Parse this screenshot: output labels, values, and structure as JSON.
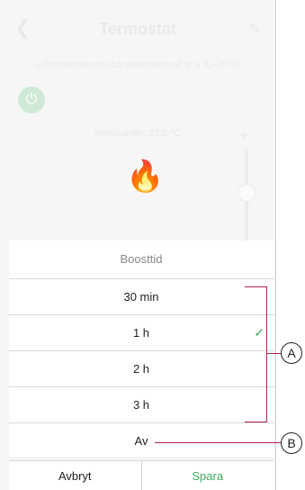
{
  "background": {
    "title": "Termostat",
    "range_text": "Lufttemperaturens börvärdesintervall är 4 ºC–30 ºC",
    "current_text": "Nuvarande: 23,5 ºC",
    "back_icon": "chevron-left-icon",
    "edit_icon": "pencil-icon",
    "power_icon": "power-icon",
    "flame_icon": "flame-icon",
    "plus_label": "+"
  },
  "sheet": {
    "title": "Boosttid",
    "options": [
      {
        "label": "30 min"
      },
      {
        "label": "1 h",
        "selected": true
      },
      {
        "label": "2 h"
      },
      {
        "label": "3 h"
      },
      {
        "label": "Av"
      }
    ],
    "cancel_label": "Avbryt",
    "save_label": "Spara"
  },
  "callouts": {
    "a": "A",
    "b": "B",
    "color": "#b01f50"
  },
  "colors": {
    "accent": "#3dab5f"
  }
}
